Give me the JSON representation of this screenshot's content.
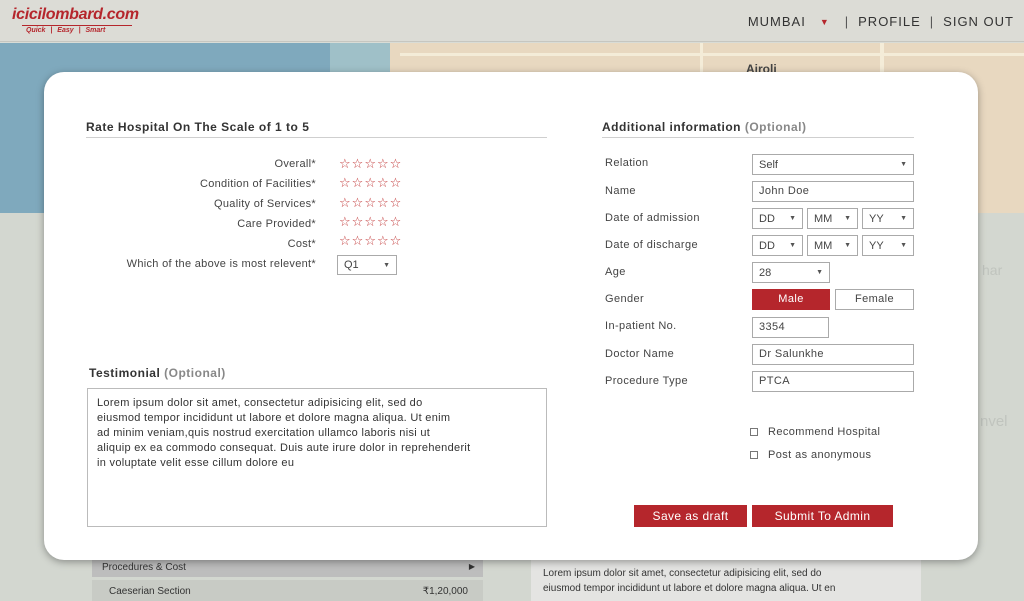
{
  "header": {
    "logo_text": "icicilombard.com",
    "logo_tagline": "Quick | Easy | Smart",
    "city": "MUMBAI",
    "separator": "|",
    "profile": "PROFILE",
    "sign_out": "SIGN OUT"
  },
  "map": {
    "label": "Airoli"
  },
  "background": {
    "side_labels": [
      "har",
      "nvel"
    ],
    "procedures_label": "Procedures & Cost",
    "procedure_row": {
      "name": "Caeserian Section",
      "amount": "₹1,20,000"
    },
    "paragraph": "Lorem ipsum dolor sit amet, consectetur  adipisicing elit, sed do\neiusmod tempor incididunt ut labore et dolore magna aliqua. Ut en"
  },
  "rating": {
    "title": "Rate Hospital On The Scale of 1 to 5",
    "items": [
      {
        "label": "Overall*",
        "stars": 0
      },
      {
        "label": "Condition of Facilities*",
        "stars": 0
      },
      {
        "label": "Quality of Services*",
        "stars": 0
      },
      {
        "label": "Care Provided*",
        "stars": 0
      },
      {
        "label": "Cost*",
        "stars": 0
      }
    ],
    "star_glyph": "☆",
    "most_relevant_label": "Which of the above is most relevent*",
    "most_relevant_value": "Q1"
  },
  "testimonial": {
    "title": "Testimonial",
    "optional": "(Optional)",
    "text": "Lorem ipsum dolor sit amet, consectetur adipisicing elit, sed do\neiusmod tempor incididunt ut labore et dolore magna aliqua. Ut enim\nad minim veniam,quis nostrud exercitation ullamco laboris nisi ut\naliquip ex ea commodo consequat. Duis aute irure dolor in reprehenderit\nin voluptate velit esse cillum dolore eu"
  },
  "additional": {
    "title": "Additional information",
    "optional": "(Optional)",
    "relation": {
      "label": "Relation",
      "value": "Self"
    },
    "name": {
      "label": "Name",
      "value": "John Doe"
    },
    "admission": {
      "label": "Date of admission",
      "dd": "DD",
      "mm": "MM",
      "yy": "YY"
    },
    "discharge": {
      "label": "Date of discharge",
      "dd": "DD",
      "mm": "MM",
      "yy": "YY"
    },
    "age": {
      "label": "Age",
      "value": "28"
    },
    "gender": {
      "label": "Gender",
      "male": "Male",
      "female": "Female",
      "selected": "Male"
    },
    "inpatient": {
      "label": "In-patient No.",
      "value": "3354"
    },
    "doctor": {
      "label": "Doctor Name",
      "value": "Dr Salunkhe"
    },
    "procedure": {
      "label": "Procedure Type",
      "value": "PTCA"
    },
    "recommend": {
      "label": "Recommend Hospital",
      "checked": false
    },
    "anonymous": {
      "label": "Post as anonymous",
      "checked": false
    }
  },
  "actions": {
    "save_draft": "Save as draft",
    "submit": "Submit To Admin"
  },
  "colors": {
    "brand": "#b5262c",
    "star": "#c23a3a"
  }
}
